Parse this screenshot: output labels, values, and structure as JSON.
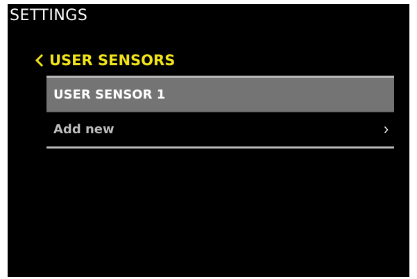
{
  "header": {
    "title": "SETTINGS"
  },
  "nav": {
    "back_label": "USER SENSORS"
  },
  "menu": {
    "items": [
      {
        "label": "USER SENSOR 1",
        "selected": true
      },
      {
        "label": "Add new",
        "selected": false,
        "has_submenu": true
      }
    ]
  },
  "colors": {
    "background": "#000000",
    "accent": "#f2e41a",
    "selected_row": "#747474",
    "rule": "#b9b9b9",
    "text_primary": "#ffffff",
    "text_secondary": "#bdbdbd"
  },
  "icons": {
    "back": "chevron-left-icon",
    "submenu": "chevron-right-icon"
  }
}
